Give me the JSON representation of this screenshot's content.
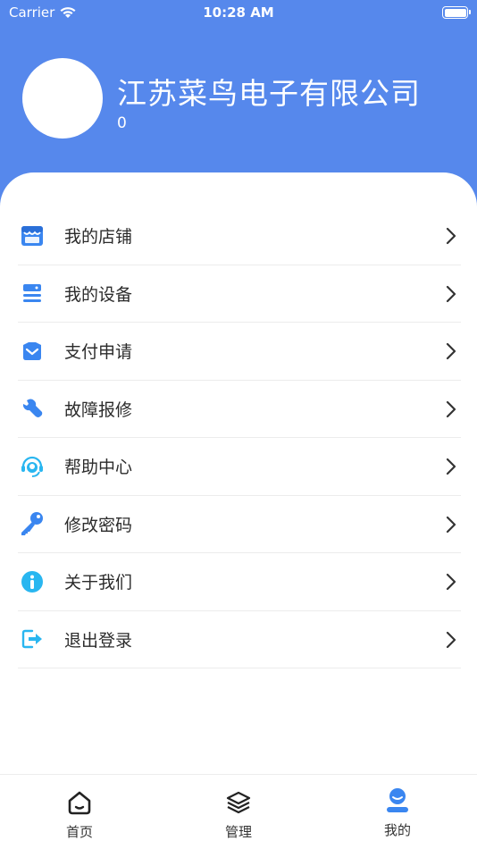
{
  "status_bar": {
    "carrier": "Carrier",
    "time": "10:28 AM"
  },
  "profile": {
    "name": "江苏菜鸟电子有限公司",
    "subtitle": "0"
  },
  "menu": {
    "items": [
      {
        "label": "我的店铺",
        "icon": "store-icon"
      },
      {
        "label": "我的设备",
        "icon": "device-icon"
      },
      {
        "label": "支付申请",
        "icon": "payment-icon"
      },
      {
        "label": "故障报修",
        "icon": "wrench-icon"
      },
      {
        "label": "帮助中心",
        "icon": "headset-icon"
      },
      {
        "label": "修改密码",
        "icon": "key-icon"
      },
      {
        "label": "关于我们",
        "icon": "info-icon"
      },
      {
        "label": "退出登录",
        "icon": "logout-icon"
      }
    ]
  },
  "tabbar": {
    "tabs": [
      {
        "label": "首页",
        "icon": "home-icon"
      },
      {
        "label": "管理",
        "icon": "layers-icon"
      },
      {
        "label": "我的",
        "icon": "profile-icon"
      }
    ],
    "active": "我的"
  },
  "colors": {
    "header": "#5688ec",
    "icon_blue": "#3a86f0",
    "icon_cyan": "#29b6f0"
  }
}
